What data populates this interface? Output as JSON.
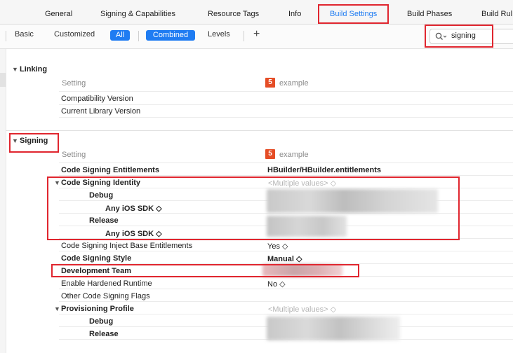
{
  "tabs": [
    "General",
    "Signing & Capabilities",
    "Resource Tags",
    "Info",
    "Build Settings",
    "Build Phases",
    "Build Rul"
  ],
  "filters": {
    "basic": "Basic",
    "customized": "Customized",
    "all": "All",
    "combined": "Combined",
    "levels": "Levels",
    "add": "+"
  },
  "search": {
    "icon": "search-icon",
    "value": "signing"
  },
  "linking": {
    "title": "Linking",
    "setting_header": "Setting",
    "target": "example",
    "rows": [
      "Compatibility Version",
      "Current Library Version"
    ]
  },
  "signing": {
    "title": "Signing",
    "setting_header": "Setting",
    "target": "example",
    "entitlements": {
      "label": "Code Signing Entitlements",
      "value": "HBuilder/HBuilder.entitlements"
    },
    "identity": {
      "label": "Code Signing Identity",
      "value": "<Multiple values> ◇",
      "debug": "Debug",
      "debug_sdk": "Any iOS SDK ◇",
      "release": "Release",
      "release_sdk": "Any iOS SDK ◇"
    },
    "inject": {
      "label": "Code Signing Inject Base Entitlements",
      "value": "Yes ◇"
    },
    "style": {
      "label": "Code Signing Style",
      "value": "Manual ◇"
    },
    "team": {
      "label": "Development Team"
    },
    "hardened": {
      "label": "Enable Hardened Runtime",
      "value": "No ◇"
    },
    "flags": {
      "label": "Other Code Signing Flags"
    },
    "profile": {
      "label": "Provisioning Profile",
      "value": "<Multiple values> ◇",
      "debug": "Debug",
      "release": "Release"
    }
  },
  "colors": {
    "accent": "#1f7cf2",
    "highlight": "#e0262f",
    "html5": "#e54d26"
  }
}
